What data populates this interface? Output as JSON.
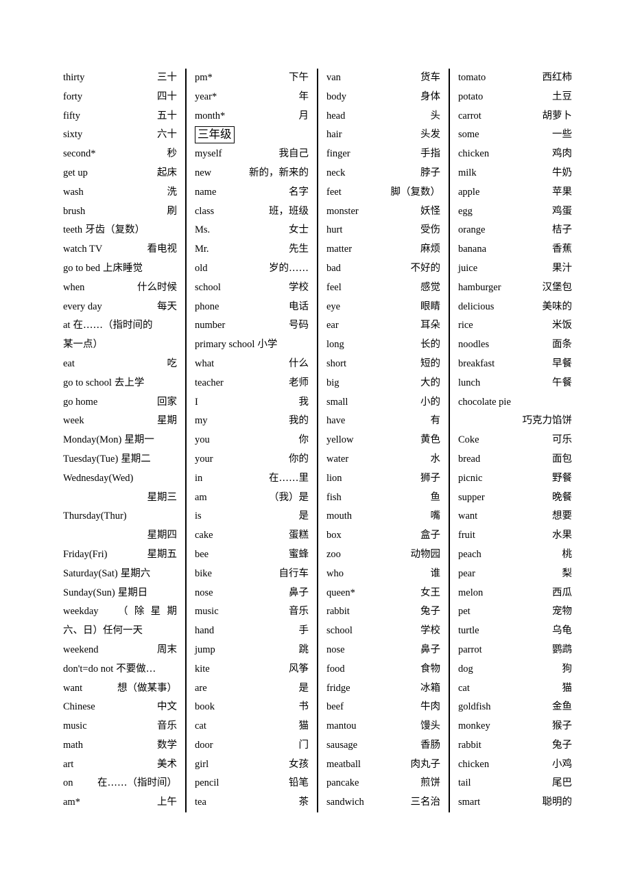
{
  "document": {
    "type": "vocabulary-list",
    "language_pair": "English-Chinese",
    "grade_header": "三年级",
    "column_count": 4
  },
  "columns": [
    {
      "id": "column-1",
      "entries": [
        {
          "en": "thirty",
          "cn": "三十"
        },
        {
          "en": "forty",
          "cn": "四十"
        },
        {
          "en": "fifty",
          "cn": "五十"
        },
        {
          "en": "sixty",
          "cn": "六十"
        },
        {
          "en": "second*",
          "cn": "秒"
        },
        {
          "en": "get up",
          "cn": "起床"
        },
        {
          "en": "wash",
          "cn": "洗",
          "mid": true
        },
        {
          "en": "brush",
          "cn": "刷"
        },
        {
          "en": "teeth",
          "cn": "牙齿（复数）",
          "tight": true
        },
        {
          "en": "watch TV",
          "cn": "看电视"
        },
        {
          "en": "go to bed",
          "cn": "上床睡觉",
          "tight": true
        },
        {
          "en": "when",
          "cn": "什么时候"
        },
        {
          "en": "every day",
          "cn": "每天"
        },
        {
          "en": "at",
          "cn": "在……（指时间的",
          "tight": true,
          "cont": "某一点）",
          "cont_align": "left"
        },
        {
          "en": "eat",
          "cn": "吃"
        },
        {
          "en": "go to school",
          "cn": "去上学",
          "tight": true
        },
        {
          "en": "go home",
          "cn": "回家"
        },
        {
          "en": "week",
          "cn": "星期"
        },
        {
          "en": "Monday(Mon)",
          "cn": "星期一",
          "tight": true
        },
        {
          "en": "Tuesday(Tue)",
          "cn": "星期二",
          "tight": true
        },
        {
          "en": "Wednesday(Wed)",
          "cn": "",
          "cont": "星期三",
          "cont_align": "right"
        },
        {
          "en": "Thursday(Thur)",
          "cn": "",
          "cont": "星期四",
          "cont_align": "right"
        },
        {
          "en": "Friday(Fri)",
          "cn": "星期五"
        },
        {
          "en": "Saturday(Sat)",
          "cn": "星期六",
          "tight": true
        },
        {
          "en": "Sunday(Sun)",
          "cn": "星期日",
          "tight": true
        },
        {
          "en": "weekday",
          "cn": "（除星期",
          "spread": true,
          "cont": "六、日）任何一天",
          "cont_align": "left"
        },
        {
          "en": "weekend",
          "cn": "周末"
        },
        {
          "en": "don't=do not",
          "cn": "不要做…",
          "tight": true
        },
        {
          "en": "want",
          "cn": "想（做某事）"
        },
        {
          "en": "Chinese",
          "cn": "中文"
        },
        {
          "en": "music",
          "cn": "音乐"
        },
        {
          "en": "math",
          "cn": "数学"
        },
        {
          "en": "art",
          "cn": "美术"
        },
        {
          "en": "on",
          "cn": "在……（指时间）"
        },
        {
          "en": "am*",
          "cn": "上午"
        }
      ]
    },
    {
      "id": "column-2",
      "entries": [
        {
          "en": "pm*",
          "cn": "下午"
        },
        {
          "en": "year*",
          "cn": "年"
        },
        {
          "en": "month*",
          "cn": "月"
        },
        {
          "grade_header": "三年级"
        },
        {
          "en": "myself",
          "cn": "我自己"
        },
        {
          "en": "new",
          "cn": "新的，新来的"
        },
        {
          "en": "name",
          "cn": "名字"
        },
        {
          "en": "class",
          "cn": "班，班级"
        },
        {
          "en": "Ms.",
          "cn": "女士"
        },
        {
          "en": "Mr.",
          "cn": "先生"
        },
        {
          "en": "old",
          "cn": "岁的……"
        },
        {
          "en": "school",
          "cn": "学校"
        },
        {
          "en": "phone",
          "cn": "电话"
        },
        {
          "en": "number",
          "cn": "号码"
        },
        {
          "en": "primary school",
          "cn": "小学",
          "tight": true
        },
        {
          "en": "what",
          "cn": "什么"
        },
        {
          "en": "teacher",
          "cn": "老师"
        },
        {
          "en": "I",
          "cn": "我"
        },
        {
          "en": "my",
          "cn": "我的"
        },
        {
          "en": "you",
          "cn": "你"
        },
        {
          "en": "your",
          "cn": "你的"
        },
        {
          "en": "in",
          "cn": "在……里"
        },
        {
          "en": "am",
          "cn": "（我）是"
        },
        {
          "en": "is",
          "cn": "是"
        },
        {
          "en": "cake",
          "cn": "蛋糕"
        },
        {
          "en": "bee",
          "cn": "蜜蜂"
        },
        {
          "en": "bike",
          "cn": "自行车"
        },
        {
          "en": "nose",
          "cn": "鼻子"
        },
        {
          "en": "music",
          "cn": "音乐"
        },
        {
          "en": "hand",
          "cn": "手"
        },
        {
          "en": "jump",
          "cn": "跳"
        },
        {
          "en": "kite",
          "cn": "风筝"
        },
        {
          "en": "are",
          "cn": "是"
        },
        {
          "en": "book",
          "cn": "书"
        },
        {
          "en": "cat",
          "cn": "猫"
        },
        {
          "en": "door",
          "cn": "门"
        },
        {
          "en": "girl",
          "cn": "女孩"
        },
        {
          "en": "pencil",
          "cn": "铅笔"
        },
        {
          "en": "tea",
          "cn": "茶"
        }
      ]
    },
    {
      "id": "column-3",
      "entries": [
        {
          "en": "van",
          "cn": "货车"
        },
        {
          "en": "body",
          "cn": "身体"
        },
        {
          "en": "head",
          "cn": "头"
        },
        {
          "en": "hair",
          "cn": "头发"
        },
        {
          "en": "finger",
          "cn": "手指"
        },
        {
          "en": "neck",
          "cn": "脖子"
        },
        {
          "en": "feet",
          "cn": "脚（复数）"
        },
        {
          "en": "monster",
          "cn": "妖怪"
        },
        {
          "en": "hurt",
          "cn": "受伤"
        },
        {
          "en": "matter",
          "cn": "麻烦"
        },
        {
          "en": "bad",
          "cn": "不好的"
        },
        {
          "en": "feel",
          "cn": "感觉"
        },
        {
          "en": "eye",
          "cn": "眼睛"
        },
        {
          "en": "ear",
          "cn": "耳朵"
        },
        {
          "en": "long",
          "cn": "长的"
        },
        {
          "en": "short",
          "cn": "短的"
        },
        {
          "en": "big",
          "cn": "大的"
        },
        {
          "en": "small",
          "cn": "小的"
        },
        {
          "en": "have",
          "cn": "有"
        },
        {
          "en": "yellow",
          "cn": "黄色"
        },
        {
          "en": "water",
          "cn": "水"
        },
        {
          "en": "lion",
          "cn": "狮子"
        },
        {
          "en": "fish",
          "cn": "鱼"
        },
        {
          "en": "mouth",
          "cn": "嘴"
        },
        {
          "en": "box",
          "cn": "盒子"
        },
        {
          "en": "zoo",
          "cn": "动物园"
        },
        {
          "en": "who",
          "cn": "谁"
        },
        {
          "en": "queen*",
          "cn": "女王"
        },
        {
          "en": "rabbit",
          "cn": "兔子"
        },
        {
          "en": "school",
          "cn": "学校"
        },
        {
          "en": "nose",
          "cn": "鼻子"
        },
        {
          "en": "food",
          "cn": "食物"
        },
        {
          "en": "fridge",
          "cn": "冰箱"
        },
        {
          "en": "beef",
          "cn": "牛肉"
        },
        {
          "en": "mantou",
          "cn": "馒头"
        },
        {
          "en": "sausage",
          "cn": "香肠"
        },
        {
          "en": "meatball",
          "cn": "肉丸子"
        },
        {
          "en": "pancake",
          "cn": "煎饼"
        },
        {
          "en": "sandwich",
          "cn": "三名治"
        }
      ]
    },
    {
      "id": "column-4",
      "entries": [
        {
          "en": "tomato",
          "cn": "西红柿"
        },
        {
          "en": "potato",
          "cn": "土豆"
        },
        {
          "en": "carrot",
          "cn": "胡萝卜"
        },
        {
          "en": "some",
          "cn": "一些"
        },
        {
          "en": "chicken",
          "cn": "鸡肉"
        },
        {
          "en": "milk",
          "cn": "牛奶"
        },
        {
          "en": "apple",
          "cn": "苹果"
        },
        {
          "en": "egg",
          "cn": "鸡蛋"
        },
        {
          "en": "orange",
          "cn": "桔子"
        },
        {
          "en": "banana",
          "cn": "香蕉"
        },
        {
          "en": "juice",
          "cn": "果汁"
        },
        {
          "en": "hamburger",
          "cn": "汉堡包"
        },
        {
          "en": "delicious",
          "cn": "美味的"
        },
        {
          "en": "rice",
          "cn": "米饭"
        },
        {
          "en": "noodles",
          "cn": "面条"
        },
        {
          "en": "breakfast",
          "cn": "早餐"
        },
        {
          "en": "lunch",
          "cn": "午餐"
        },
        {
          "en": "chocolate pie",
          "cn": "",
          "cont": "巧克力馅饼",
          "cont_align": "right"
        },
        {
          "en": "Coke",
          "cn": "可乐"
        },
        {
          "en": "bread",
          "cn": "面包"
        },
        {
          "en": "picnic",
          "cn": "野餐"
        },
        {
          "en": "supper",
          "cn": "晚餐"
        },
        {
          "en": "want",
          "cn": "想要"
        },
        {
          "en": "fruit",
          "cn": "水果"
        },
        {
          "en": "peach",
          "cn": "桃"
        },
        {
          "en": "pear",
          "cn": "梨"
        },
        {
          "en": "melon",
          "cn": "西瓜"
        },
        {
          "en": "pet",
          "cn": "宠物"
        },
        {
          "en": "turtle",
          "cn": "乌龟"
        },
        {
          "en": "parrot",
          "cn": "鹦鹉"
        },
        {
          "en": "dog",
          "cn": "狗"
        },
        {
          "en": "cat",
          "cn": "猫"
        },
        {
          "en": "goldfish",
          "cn": "金鱼"
        },
        {
          "en": "monkey",
          "cn": "猴子"
        },
        {
          "en": "rabbit",
          "cn": "兔子"
        },
        {
          "en": "chicken",
          "cn": "小鸡"
        },
        {
          "en": "tail",
          "cn": "尾巴"
        },
        {
          "en": "smart",
          "cn": "聪明的"
        }
      ]
    }
  ]
}
